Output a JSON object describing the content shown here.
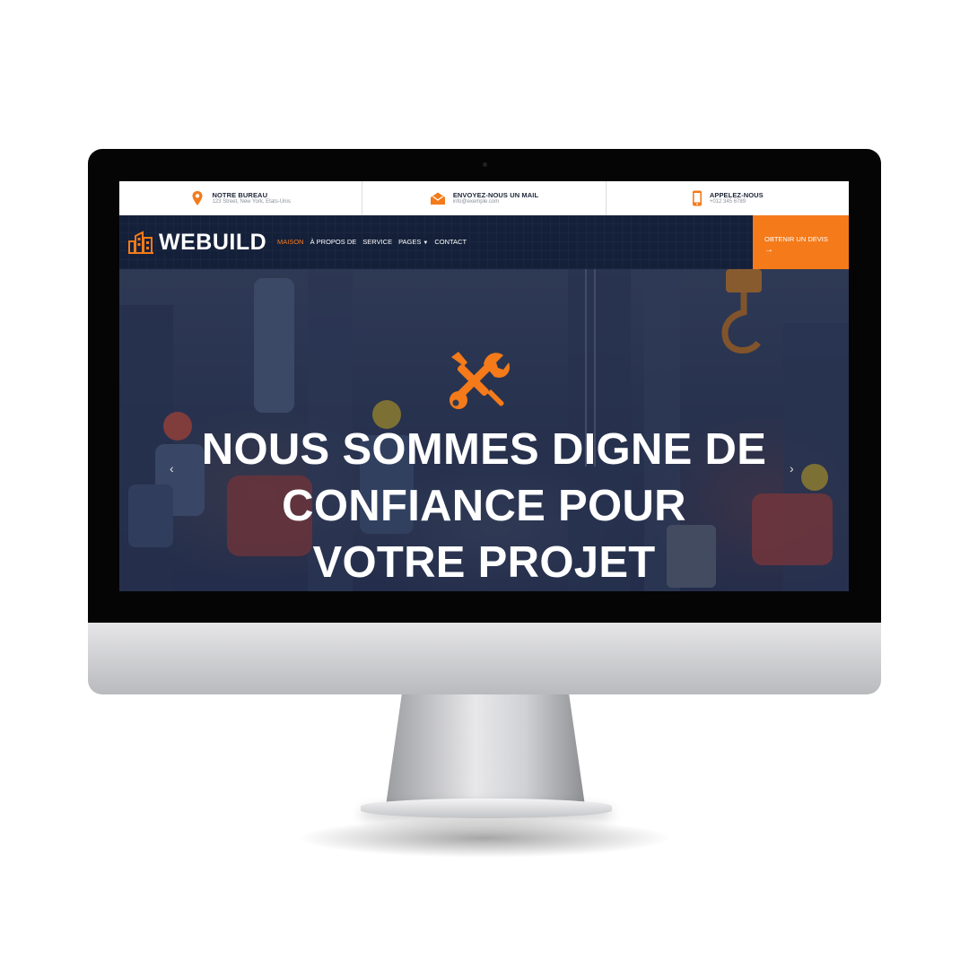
{
  "topbar": {
    "items": [
      {
        "title": "NOTRE BUREAU",
        "subtitle": "123 Street, New York, Etats-Unis",
        "icon": "map-marker-icon"
      },
      {
        "title": "ENVOYEZ-NOUS UN MAIL",
        "subtitle": "info@exemple.com",
        "icon": "envelope-open-icon"
      },
      {
        "title": "APPELEZ-NOUS",
        "subtitle": "+012 345 6789",
        "icon": "mobile-phone-icon"
      }
    ]
  },
  "nav": {
    "logo": "WEBUILD",
    "items": [
      "MAISON",
      "À PROPOS DE",
      "SERVICE",
      "PAGES",
      "CONTACT"
    ],
    "cta": "OBTENIR UN DEVIS",
    "cta_arrow": "→"
  },
  "hero": {
    "title": "NOUS SOMMES DIGNE DE CONFIANCE POUR VOTRE PROJET",
    "prev": "‹",
    "next": "›"
  },
  "colors": {
    "accent": "#f47a1a",
    "navy": "#142039",
    "white": "#ffffff"
  }
}
